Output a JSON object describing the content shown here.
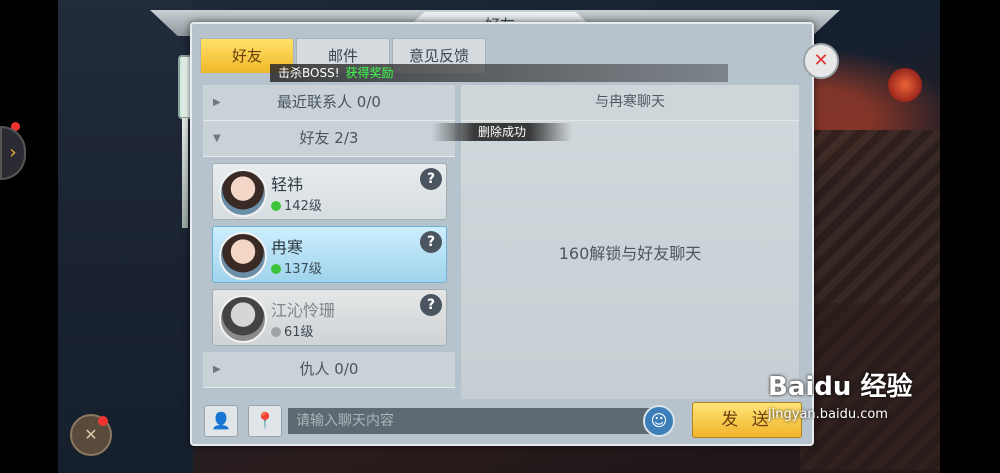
{
  "window": {
    "title": "好友"
  },
  "tabs": [
    {
      "label": "好友",
      "active": true
    },
    {
      "label": "邮件",
      "active": false
    },
    {
      "label": "意见反馈",
      "active": false
    }
  ],
  "notice": {
    "text": "击杀BOSS!",
    "highlight": "获得奖励"
  },
  "toast": "删除成功",
  "left_list": {
    "recent_group": "最近联系人 0/0",
    "friend_group": "好友 2/3",
    "enemy_group": "仇人 0/0",
    "friends": [
      {
        "name": "轻祎",
        "level": "142级",
        "online": true,
        "selected": false
      },
      {
        "name": "冉寒",
        "level": "137级",
        "online": true,
        "selected": true
      },
      {
        "name": "江沁怜珊",
        "level": "61级",
        "online": false,
        "selected": false
      }
    ],
    "help_glyph": "?"
  },
  "chat": {
    "header": "与冉寒聊天",
    "lock_message": "160解锁与好友聊天",
    "input_placeholder": "请输入聊天内容",
    "send_label": "发 送"
  },
  "watermark": {
    "logo": "Baidu 经验",
    "url": "jingyan.baidu.com"
  },
  "colors": {
    "accent": "#f2b42b",
    "online": "#3ec43a",
    "selected_row": "#9fd4ec"
  }
}
